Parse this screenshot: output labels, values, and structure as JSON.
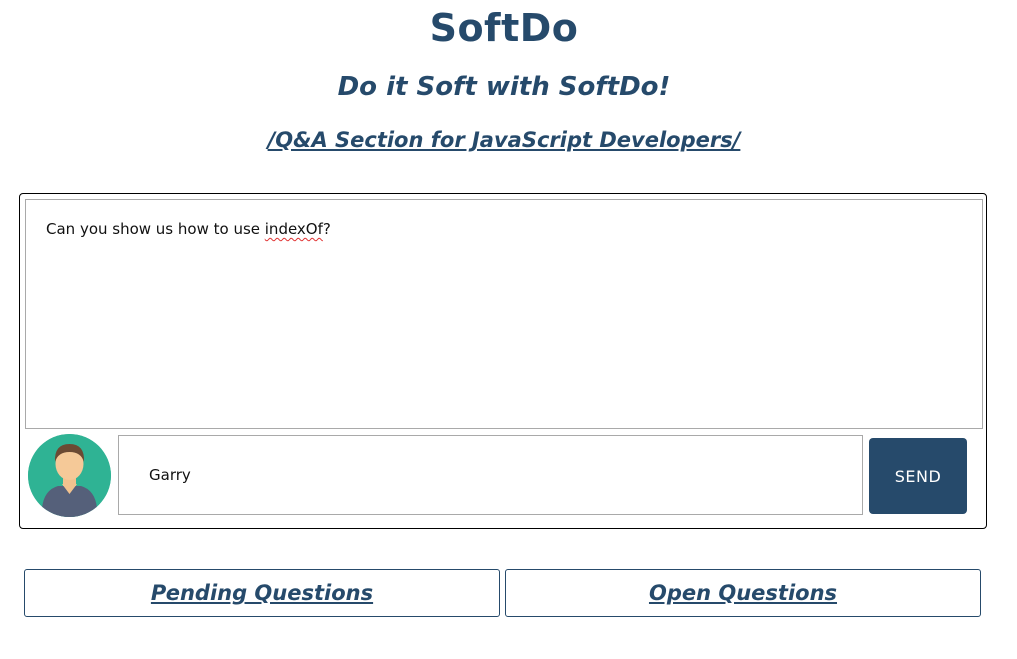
{
  "header": {
    "title": "SoftDo",
    "subtitle": "Do it Soft with SoftDo!",
    "section_link": "/Q&A Section for JavaScript Developers/"
  },
  "question": {
    "text_before": "Can you show us how to use ",
    "text_misspelled": "indexOf",
    "text_after": "?"
  },
  "author": {
    "avatar_icon": "user-avatar-icon",
    "name_value": "Garry"
  },
  "actions": {
    "send_label": "SEND"
  },
  "tabs": [
    {
      "label": "Pending Questions"
    },
    {
      "label": "Open Questions"
    }
  ],
  "colors": {
    "brand": "#264a6b",
    "avatar_bg": "#2fb394",
    "spellcheck": "#e03030"
  }
}
